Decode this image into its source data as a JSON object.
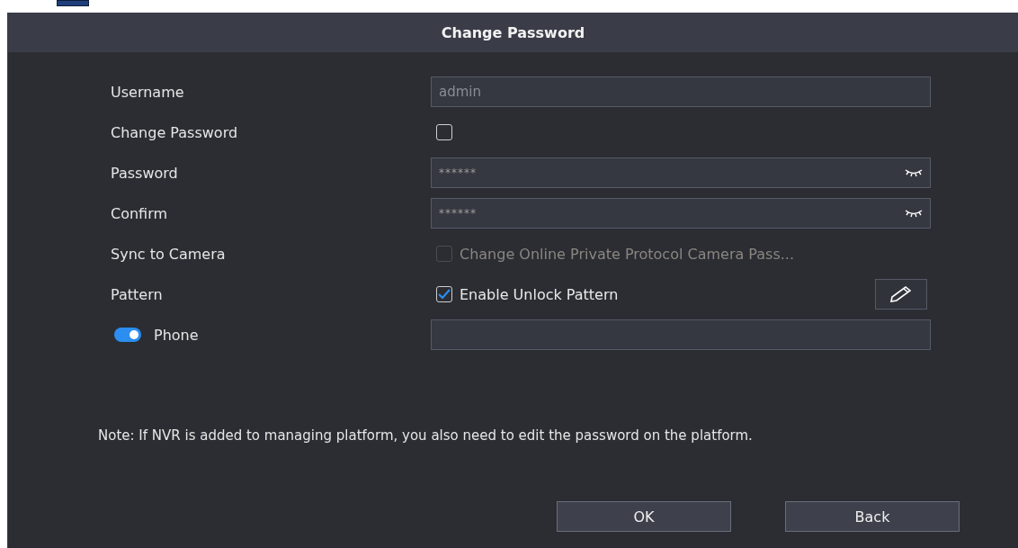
{
  "dialog": {
    "title": "Change Password"
  },
  "rows": [
    {
      "kind": "field",
      "label": "Username",
      "value": "admin",
      "disabled": true
    },
    {
      "kind": "checkbox",
      "label": "Change Password",
      "checked": false,
      "disabled": false
    },
    {
      "kind": "password",
      "label": "Password",
      "value": "******"
    },
    {
      "kind": "password",
      "label": "Confirm",
      "value": "******"
    },
    {
      "kind": "checkbox",
      "label": "Sync to Camera",
      "text": "Change Online Private Protocol Camera Pass...",
      "checked": false,
      "disabled": true
    },
    {
      "kind": "pattern",
      "label": "Pattern",
      "text": "Enable Unlock Pattern",
      "checked": true,
      "disabled": false
    },
    {
      "kind": "toggle-field",
      "label": "Phone",
      "on": true,
      "value": ""
    }
  ],
  "note": "Note: If NVR is added to managing platform, you also need to edit the password on the platform.",
  "buttons": [
    "OK",
    "Back"
  ]
}
